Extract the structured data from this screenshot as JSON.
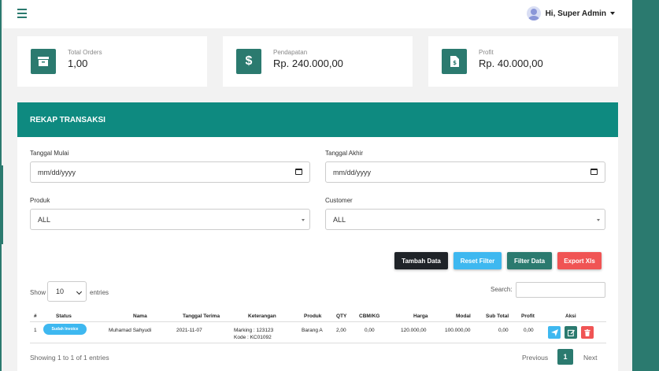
{
  "header": {
    "user_label": "Hi, Super Admin"
  },
  "stats": [
    {
      "label": "Total Orders",
      "value": "1,00"
    },
    {
      "label": "Pendapatan",
      "value": "Rp. 240.000,00"
    },
    {
      "label": "Profit",
      "value": "Rp. 40.000,00"
    }
  ],
  "panel": {
    "title": "REKAP TRANSAKSI",
    "filters": {
      "start_label": "Tanggal Mulai",
      "start_placeholder": "mm/dd/yyyy",
      "end_label": "Tanggal Akhir",
      "end_placeholder": "mm/dd/yyyy",
      "product_label": "Produk",
      "product_value": "ALL",
      "customer_label": "Customer",
      "customer_value": "ALL"
    },
    "buttons": {
      "add": "Tambah Data",
      "reset": "Reset Filter",
      "filter": "Filter Data",
      "export": "Export Xls"
    },
    "table_controls": {
      "show_label": "Show",
      "entries_value": "10",
      "entries_label": "entries",
      "search_label": "Search:"
    },
    "columns": [
      "#",
      "Status",
      "Nama",
      "Tanggal Terima",
      "Keterangan",
      "Produk",
      "QTY",
      "CBM/KG",
      "Harga",
      "Modal",
      "Sub Total",
      "Profit",
      "Aksi"
    ],
    "rows": [
      {
        "no": "1",
        "status": "Sudah Invoice",
        "nama": "Muhamad Sahyudi",
        "tanggal": "2021-11-07",
        "keterangan_1": "Marking : 123123",
        "keterangan_2": "Kode : KC01092",
        "produk": "Barang A",
        "qty": "2,00",
        "cbm": "0,00",
        "harga": "120.000,00",
        "modal": "100.000,00",
        "subtotal": "0,00",
        "profit": "0,00"
      }
    ],
    "footer": {
      "info": "Showing 1 to 1 of 1 entries",
      "previous": "Previous",
      "current_page": "1",
      "next": "Next"
    }
  },
  "colors": {
    "primary": "#2b7a6f",
    "header_bar": "#0e8a80",
    "info": "#3eb8f0",
    "danger": "#f05454",
    "dark": "#1f2328"
  }
}
